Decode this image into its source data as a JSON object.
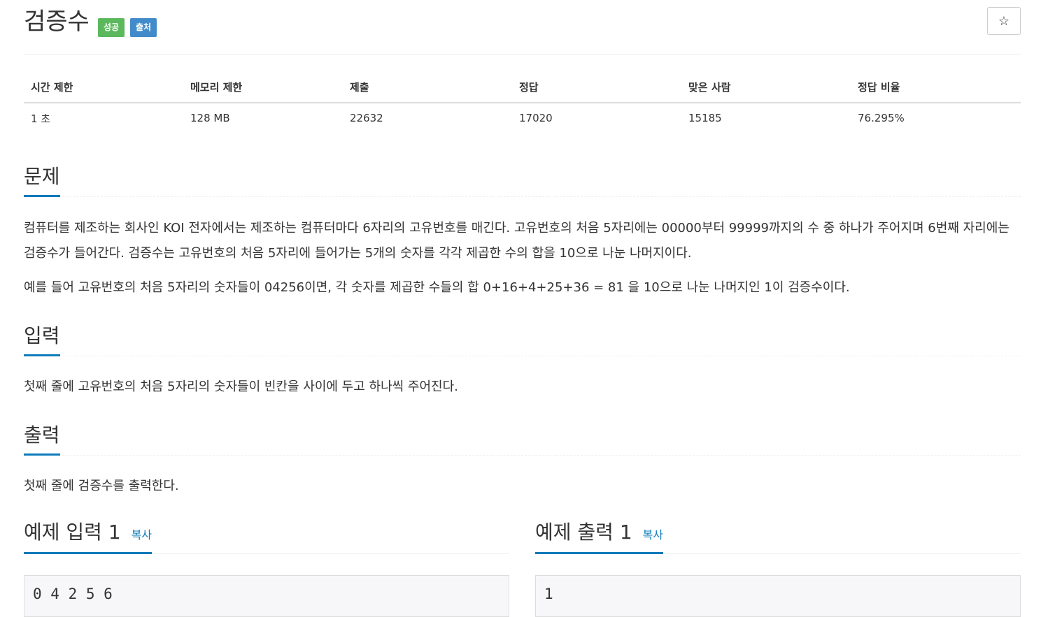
{
  "problem": {
    "title": "검증수",
    "badges": {
      "success": "성공",
      "source": "출처"
    },
    "star_icon": "☆"
  },
  "info_table": {
    "headers": [
      "시간 제한",
      "메모리 제한",
      "제출",
      "정답",
      "맞은 사람",
      "정답 비율"
    ],
    "values": [
      "1 초",
      "128 MB",
      "22632",
      "17020",
      "15185",
      "76.295%"
    ]
  },
  "sections": {
    "problem_heading": "문제",
    "problem_p1": "컴퓨터를 제조하는 회사인 KOI 전자에서는 제조하는 컴퓨터마다 6자리의 고유번호를 매긴다. 고유번호의 처음 5자리에는 00000부터 99999까지의 수 중 하나가 주어지며 6번째 자리에는 검증수가 들어간다. 검증수는 고유번호의 처음 5자리에 들어가는 5개의 숫자를 각각 제곱한 수의 합을 10으로 나눈 나머지이다.",
    "problem_p2": "예를 들어 고유번호의 처음 5자리의 숫자들이 04256이면, 각 숫자를 제곱한 수들의 합 0+16+4+25+36 = 81 을 10으로 나눈 나머지인 1이 검증수이다.",
    "input_heading": "입력",
    "input_text": "첫째 줄에 고유번호의 처음 5자리의 숫자들이 빈칸을 사이에 두고 하나씩 주어진다.",
    "output_heading": "출력",
    "output_text": "첫째 줄에 검증수를 출력한다."
  },
  "examples": {
    "input_label": "예제 입력 1",
    "output_label": "예제 출력 1",
    "copy_label": "복사",
    "input_value": "0 4 2 5 6",
    "output_value": "1"
  }
}
